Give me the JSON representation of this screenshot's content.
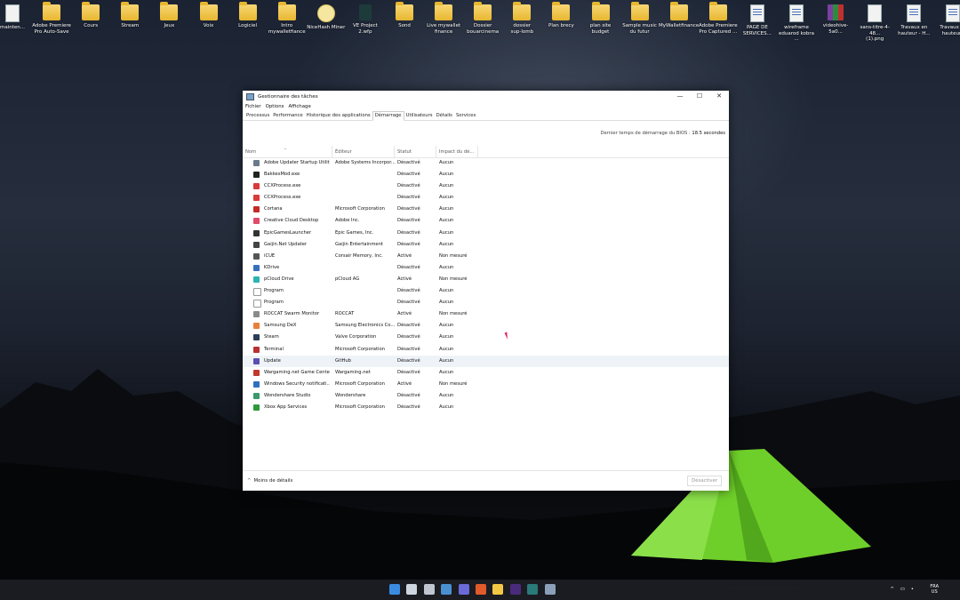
{
  "desktop": {
    "icons": [
      {
        "label": "mainten...",
        "kind": "file"
      },
      {
        "label": "Adobe Premiere\nPro Auto-Save",
        "kind": "folder"
      },
      {
        "label": "Cours",
        "kind": "folder"
      },
      {
        "label": "Stream",
        "kind": "folder"
      },
      {
        "label": "Jeux",
        "kind": "folder"
      },
      {
        "label": "Voix",
        "kind": "folder"
      },
      {
        "label": "Logiciel",
        "kind": "folder"
      },
      {
        "label": "Intro\nmywalletfiance",
        "kind": "folder"
      },
      {
        "label": "NiceHash Miner",
        "kind": "nicehash"
      },
      {
        "label": "VE Project 2.wfp",
        "kind": "vp"
      },
      {
        "label": "Sond",
        "kind": "folder"
      },
      {
        "label": "Live mywallet\nfinance",
        "kind": "folder"
      },
      {
        "label": "Dossier\nbouarcinema",
        "kind": "folder"
      },
      {
        "label": "dossier\nsup-lomb",
        "kind": "folder"
      },
      {
        "label": "Plan brecy",
        "kind": "folder"
      },
      {
        "label": "plan site budget",
        "kind": "folder"
      },
      {
        "label": "Sample music\ndu futur",
        "kind": "folder"
      },
      {
        "label": "MyWalletfinance",
        "kind": "folder"
      },
      {
        "label": "Adobe Premiere\nPro Captured ...",
        "kind": "folder"
      },
      {
        "label": "PAGE DE\nSERVICES...",
        "kind": "doc"
      },
      {
        "label": "wireframe\neduarod kobra ...",
        "kind": "doc"
      },
      {
        "label": "videohive-5a0...",
        "kind": "rar"
      },
      {
        "label": "sans-titre-4-48...\n(1).png",
        "kind": "file"
      },
      {
        "label": "Travaux en\nhauteur - H...",
        "kind": "doc"
      },
      {
        "label": "Travaux en\nhauteur -",
        "kind": "doc"
      }
    ]
  },
  "window": {
    "title": "Gestionnaire des tâches",
    "controls": {
      "minimize": "—",
      "maximize": "☐",
      "close": "✕"
    },
    "menu": [
      "Fichier",
      "Options",
      "Affichage"
    ],
    "tabs": [
      {
        "label": "Processus",
        "active": false
      },
      {
        "label": "Performance",
        "active": false
      },
      {
        "label": "Historique des applications",
        "active": false
      },
      {
        "label": "Démarrage",
        "active": true
      },
      {
        "label": "Utilisateurs",
        "active": false
      },
      {
        "label": "Détails",
        "active": false
      },
      {
        "label": "Services",
        "active": false
      }
    ],
    "bios_label": "Dernier temps de démarrage du BIOS :",
    "bios_value": "18.5 secondes",
    "columns": {
      "name": "Nom",
      "publisher": "Éditeur",
      "status": "Statut",
      "impact": "Impact du dé..."
    },
    "rows": [
      {
        "name": "Adobe Updater Startup Utility",
        "publisher": "Adobe Systems Incorpor...",
        "status": "Désactivé",
        "impact": "Aucun",
        "icon": "adobe-updater-icon",
        "color": "#6a7a8a"
      },
      {
        "name": "BakkesMod.exe",
        "publisher": "",
        "status": "Désactivé",
        "impact": "Aucun",
        "icon": "bakkesmod-icon",
        "color": "#222222"
      },
      {
        "name": "CCXProcess.exe",
        "publisher": "",
        "status": "Désactivé",
        "impact": "Aucun",
        "icon": "ccx-icon",
        "color": "#d93a3a"
      },
      {
        "name": "CCXProcess.exe",
        "publisher": "",
        "status": "Désactivé",
        "impact": "Aucun",
        "icon": "ccx-icon",
        "color": "#d93a3a"
      },
      {
        "name": "Cortana",
        "publisher": "Microsoft Corporation",
        "status": "Désactivé",
        "impact": "Aucun",
        "icon": "cortana-icon",
        "color": "#c42b2b"
      },
      {
        "name": "Creative Cloud Desktop",
        "publisher": "Adobe Inc.",
        "status": "Désactivé",
        "impact": "Aucun",
        "icon": "creative-cloud-icon",
        "color": "#e04a6a"
      },
      {
        "name": "EpicGamesLauncher",
        "publisher": "Epic Games, Inc.",
        "status": "Désactivé",
        "impact": "Aucun",
        "icon": "epic-games-icon",
        "color": "#333333"
      },
      {
        "name": "Gaijin.Net Updater",
        "publisher": "Gaijin Entertainment",
        "status": "Désactivé",
        "impact": "Aucun",
        "icon": "gaijin-icon",
        "color": "#444444"
      },
      {
        "name": "iCUE",
        "publisher": "Corsair Memory, Inc.",
        "status": "Activé",
        "impact": "Non mesuré",
        "icon": "icue-icon",
        "color": "#555555"
      },
      {
        "name": "KDrive",
        "publisher": "",
        "status": "Désactivé",
        "impact": "Aucun",
        "icon": "kdrive-icon",
        "color": "#3a6fc0"
      },
      {
        "name": "pCloud Drive",
        "publisher": "pCloud AG",
        "status": "Activé",
        "impact": "Non mesuré",
        "icon": "pcloud-icon",
        "color": "#2bb3b3"
      },
      {
        "name": "Program",
        "publisher": "",
        "status": "Désactivé",
        "impact": "Aucun",
        "icon": "program-icon",
        "color": "#ffffff"
      },
      {
        "name": "Program",
        "publisher": "",
        "status": "Désactivé",
        "impact": "Aucun",
        "icon": "program-icon",
        "color": "#ffffff"
      },
      {
        "name": "ROCCAT Swarm Monitor",
        "publisher": "ROCCAT",
        "status": "Activé",
        "impact": "Non mesuré",
        "icon": "roccat-icon",
        "color": "#8a8a8a"
      },
      {
        "name": "Samsung DeX",
        "publisher": "Samsung Electronics Co...",
        "status": "Désactivé",
        "impact": "Aucun",
        "icon": "samsung-dex-icon",
        "color": "#e8803a"
      },
      {
        "name": "Steam",
        "publisher": "Valve Corporation",
        "status": "Désactivé",
        "impact": "Aucun",
        "icon": "steam-icon",
        "color": "#2a3f5a"
      },
      {
        "name": "Terminal",
        "publisher": "Microsoft Corporation",
        "status": "Désactivé",
        "impact": "Aucun",
        "icon": "terminal-icon",
        "color": "#b83232"
      },
      {
        "name": "Update",
        "publisher": "GitHub",
        "status": "Désactivé",
        "impact": "Aucun",
        "icon": "github-icon",
        "color": "#5a4fb0",
        "selected": true
      },
      {
        "name": "Wargaming.net Game Center",
        "publisher": "Wargaming.net",
        "status": "Désactivé",
        "impact": "Aucun",
        "icon": "wargaming-icon",
        "color": "#c0392b"
      },
      {
        "name": "Windows Security notificati...",
        "publisher": "Microsoft Corporation",
        "status": "Activé",
        "impact": "Non mesuré",
        "icon": "shield-icon",
        "color": "#2f6fc0"
      },
      {
        "name": "Wondershare Studio",
        "publisher": "Wondershare",
        "status": "Désactivé",
        "impact": "Aucun",
        "icon": "wondershare-icon",
        "color": "#3a9a6a"
      },
      {
        "name": "Xbox App Services",
        "publisher": "Microsoft Corporation",
        "status": "Désactivé",
        "impact": "Aucun",
        "icon": "xbox-icon",
        "color": "#2e9a3a"
      }
    ],
    "footer": {
      "less_details": "Moins de détails",
      "disable": "Désactiver"
    }
  },
  "taskbar": {
    "icons": [
      {
        "name": "start-icon",
        "color": "#3a8be0"
      },
      {
        "name": "search-icon",
        "color": "#cfd6e0"
      },
      {
        "name": "task-view-icon",
        "color": "#bfc6d0"
      },
      {
        "name": "widgets-icon",
        "color": "#4a90d0"
      },
      {
        "name": "chat-icon",
        "color": "#6a6ad8"
      },
      {
        "name": "brave-icon",
        "color": "#e05a2a"
      },
      {
        "name": "file-explorer-icon",
        "color": "#f2c744"
      },
      {
        "name": "premiere-icon",
        "color": "#4a2a7a"
      },
      {
        "name": "vegas-icon",
        "color": "#2a7a7a"
      },
      {
        "name": "task-manager-icon",
        "color": "#8aa0b8"
      }
    ],
    "language": "FRA\nUS"
  }
}
